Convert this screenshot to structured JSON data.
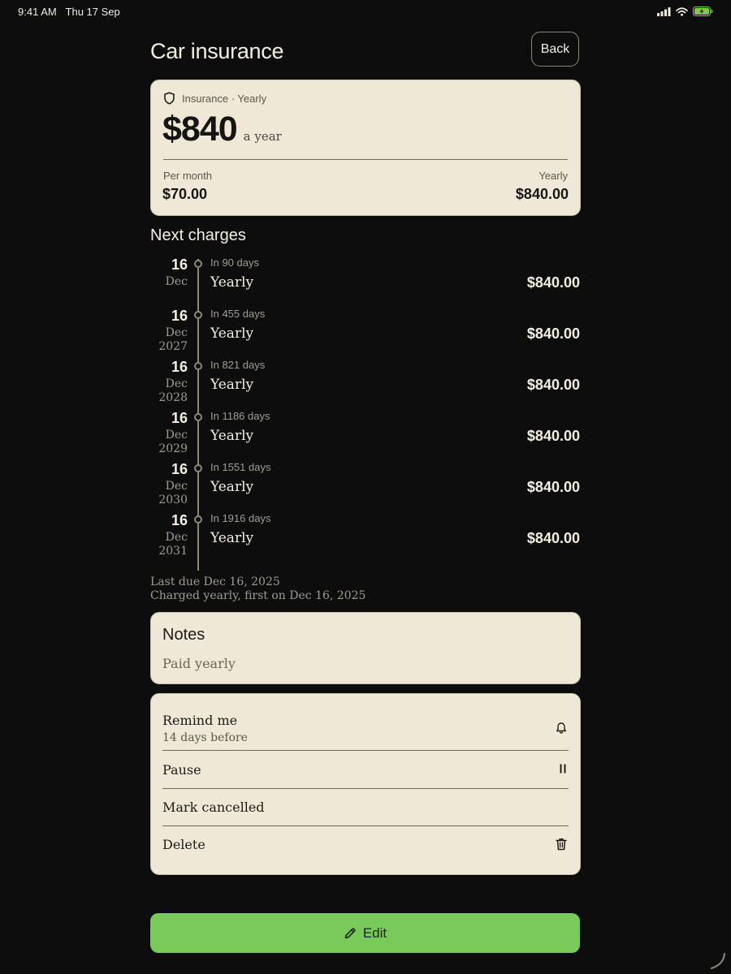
{
  "status": {
    "time": "9:41 AM",
    "date": "Thu 17 Sep"
  },
  "header": {
    "title": "Car insurance",
    "back_label": "Back"
  },
  "summary": {
    "kicker": "Insurance · Yearly",
    "price": "$840",
    "price_unit": "a year",
    "per_month_label": "Per month",
    "per_month_value": "$70.00",
    "yearly_label": "Yearly",
    "yearly_value": "$840.00"
  },
  "next_charges": {
    "title": "Next charges",
    "items": [
      {
        "day": "16",
        "month": "Dec",
        "year": "",
        "when": "In 90 days",
        "label": "Yearly",
        "amount": "$840.00"
      },
      {
        "day": "16",
        "month": "Dec",
        "year": "2027",
        "when": "In 455 days",
        "label": "Yearly",
        "amount": "$840.00"
      },
      {
        "day": "16",
        "month": "Dec",
        "year": "2028",
        "when": "In 821 days",
        "label": "Yearly",
        "amount": "$840.00"
      },
      {
        "day": "16",
        "month": "Dec",
        "year": "2029",
        "when": "In 1186 days",
        "label": "Yearly",
        "amount": "$840.00"
      },
      {
        "day": "16",
        "month": "Dec",
        "year": "2030",
        "when": "In 1551 days",
        "label": "Yearly",
        "amount": "$840.00"
      },
      {
        "day": "16",
        "month": "Dec",
        "year": "2031",
        "when": "In 1916 days",
        "label": "Yearly",
        "amount": "$840.00"
      }
    ]
  },
  "meta": {
    "last_due": "Last due Dec 16, 2025",
    "charged": "Charged yearly, first on Dec 16, 2025"
  },
  "notes": {
    "title": "Notes",
    "body": "Paid yearly"
  },
  "actions": {
    "remind_label": "Remind me",
    "remind_sub": "14 days before",
    "pause_label": "Pause",
    "cancel_label": "Mark cancelled",
    "delete_label": "Delete"
  },
  "edit_label": "Edit",
  "colors": {
    "background": "#0d0d0d",
    "card": "#efe8d6",
    "accent_green": "#79c95b",
    "text_light": "#f4efe2"
  },
  "icons": [
    "signal-icon",
    "wifi-icon",
    "battery-charging-icon",
    "shield-icon",
    "bell-icon",
    "pause-icon",
    "trash-icon",
    "pencil-icon"
  ]
}
